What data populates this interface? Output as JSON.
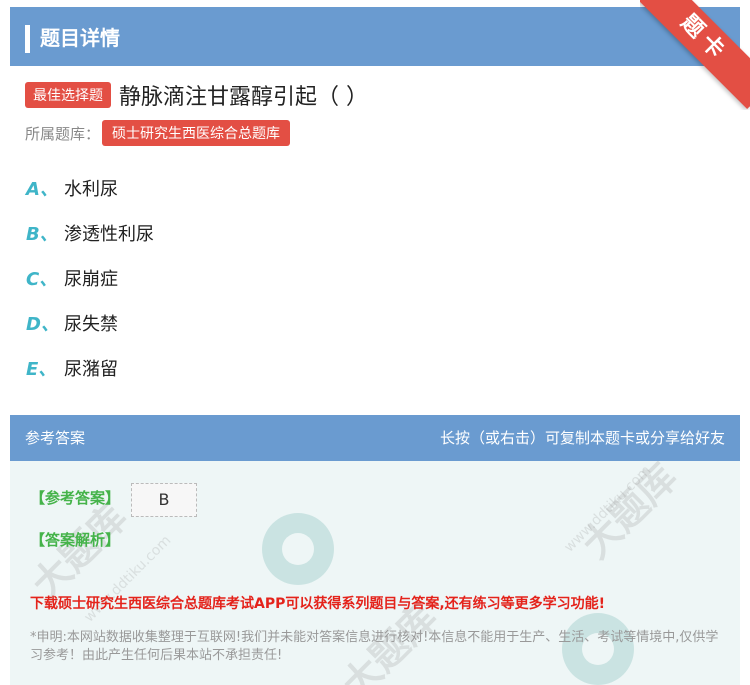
{
  "header": {
    "title": "题目详情"
  },
  "corner_badge": "题卡",
  "question": {
    "type_badge": "最佳选择题",
    "text": "静脉滴注甘露醇引起（ ）",
    "library_label": "所属题库：",
    "library_name": "硕士研究生西医综合总题库"
  },
  "options": [
    {
      "letter": "A",
      "sep": "、",
      "text": "水利尿"
    },
    {
      "letter": "B",
      "sep": "、",
      "text": "渗透性利尿"
    },
    {
      "letter": "C",
      "sep": "、",
      "text": "尿崩症"
    },
    {
      "letter": "D",
      "sep": "、",
      "text": "尿失禁"
    },
    {
      "letter": "E",
      "sep": "、",
      "text": "尿潴留"
    }
  ],
  "answer_bar": {
    "left": "参考答案",
    "right": "长按（或右击）可复制本题卡或分享给好友"
  },
  "answer": {
    "answer_label": "【参考答案】",
    "answer_value": "B",
    "analysis_label": "【答案解析】",
    "promo": "下载硕士研究生西医综合总题库考试APP可以获得系列题目与答案,还有练习等更多学习功能!",
    "disclaimer": "*申明:本网站数据收集整理于互联网!我们并未能对答案信息进行核对!本信息不能用于生产、生活、考试等情境中,仅供学习参考！由此产生任何后果本站不承担责任!"
  },
  "colors": {
    "header": "#6a9bd0",
    "badge": "#e34f44",
    "option_letter": "#3fb5c8",
    "green": "#45b34a",
    "promo": "#e4231b"
  }
}
